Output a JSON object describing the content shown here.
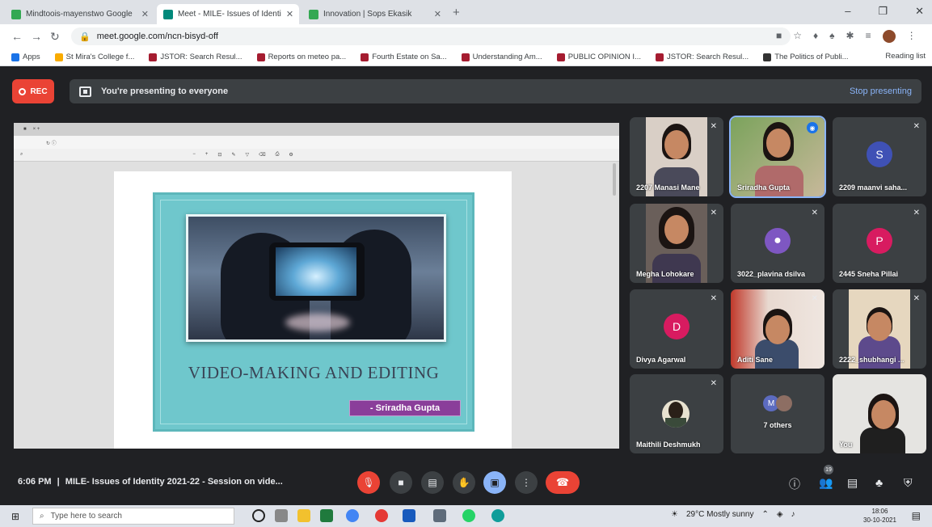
{
  "browser": {
    "tabs": [
      {
        "label": "Mindtoois-mayenstwo Google",
        "color": "#34a853"
      },
      {
        "label": "Meet - MILE- Issues of Identi",
        "color": "#00897b"
      },
      {
        "label": "Innovation | Sops Ekasik",
        "color": "#34a853"
      }
    ],
    "url": "meet.google.com/ncn-bisyd-off",
    "bookmarks": [
      "Apps",
      "St Mira's College f...",
      "JSTOR: Search Resul...",
      "Reports on meteo pa...",
      "Fourth Estate on Sa...",
      "Understanding Am...",
      "PUBLIC OPINION I...",
      "JSTOR: Search Resul...",
      "The Politics of Publi..."
    ],
    "reading_list": "Reading list"
  },
  "meet": {
    "rec_label": "REC",
    "presenting_text": "You're presenting to everyone",
    "stop_label": "Stop presenting",
    "time": "6:06 PM",
    "separator": "|",
    "meeting_title": "MILE- Issues of Identity 2021-22 - Session on vide...",
    "participants_count": "19"
  },
  "shared_screen": {
    "slide_title": "VIDEO-MAKING AND EDITING",
    "slide_author": "- Sriradha Gupta"
  },
  "participants": [
    {
      "name": "2207 Manasi Mane",
      "type": "video"
    },
    {
      "name": "Sriradha Gupta",
      "type": "video",
      "speaking": true
    },
    {
      "name": "2209 maanvi saha...",
      "type": "initial",
      "initial": "S",
      "color": "#3f51b5"
    },
    {
      "name": "Megha Lohokare",
      "type": "video"
    },
    {
      "name": "3022_plavina dsilva",
      "type": "avatar",
      "color": "#7e57c2"
    },
    {
      "name": "2445 Sneha Pillai",
      "type": "initial",
      "initial": "P",
      "color": "#d81b60"
    },
    {
      "name": "Divya Agarwal",
      "type": "initial",
      "initial": "D",
      "color": "#d81b60"
    },
    {
      "name": "Aditi Sane",
      "type": "video"
    },
    {
      "name": "2222_shubhangi ...",
      "type": "video"
    },
    {
      "name": "Maithili Deshmukh",
      "type": "photo"
    },
    {
      "name": "7 others",
      "type": "others",
      "initial": "M"
    },
    {
      "name": "You",
      "type": "video"
    }
  ],
  "taskbar": {
    "search_placeholder": "Type here to search",
    "weather": "29°C  Mostly sunny",
    "time": "18:06",
    "date": "30-10-2021"
  }
}
